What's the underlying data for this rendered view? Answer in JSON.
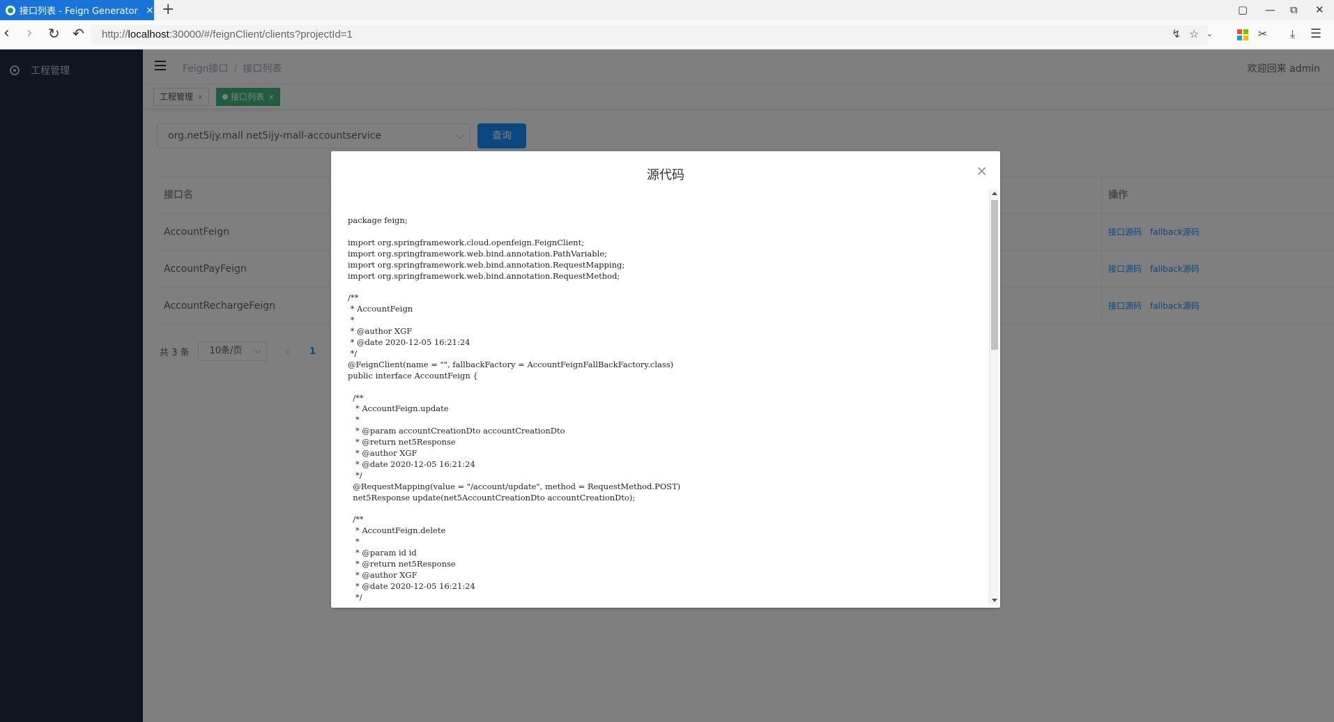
{
  "browser": {
    "tab_title": "接口列表 - Feign Generator S",
    "tab_close": "×",
    "new_tab": "+",
    "url_prefix": "http://",
    "url_host": "localhost",
    "url_rest": ":30000/#/feignClient/clients?projectId=1"
  },
  "sidebar": {
    "items": [
      {
        "label": "工程管理",
        "icon": "dashboard-icon"
      }
    ]
  },
  "navbar": {
    "breadcrumb": [
      "Feign接口",
      "接口列表"
    ],
    "breadcrumb_sep": "/",
    "welcome": "欢迎回来 admin"
  },
  "tags": [
    {
      "label": "工程管理",
      "active": false
    },
    {
      "label": "接口列表",
      "active": true
    }
  ],
  "filter": {
    "selected": "org.net5ijy.mall net5ijy-mall-accountservice",
    "query_label": "查询"
  },
  "table": {
    "headers": {
      "name": "接口名",
      "ops": "操作"
    },
    "rows": [
      {
        "name": "AccountFeign",
        "op1": "接口源码",
        "op2": "fallback源码"
      },
      {
        "name": "AccountPayFeign",
        "op1": "接口源码",
        "op2": "fallback源码"
      },
      {
        "name": "AccountRechargeFeign",
        "op1": "接口源码",
        "op2": "fallback源码"
      }
    ]
  },
  "pagination": {
    "total": "共 3 条",
    "page_size": "10条/页",
    "prev": "‹",
    "current": "1"
  },
  "dialog": {
    "title": "源代码",
    "close": "×",
    "code": "package feign;\n\nimport org.springframework.cloud.openfeign.FeignClient;\nimport org.springframework.web.bind.annotation.PathVariable;\nimport org.springframework.web.bind.annotation.RequestMapping;\nimport org.springframework.web.bind.annotation.RequestMethod;\n\n/**\n * AccountFeign\n *\n * @author XGF\n * @date 2020-12-05 16:21:24\n */\n@FeignClient(name = \"\", fallbackFactory = AccountFeignFallBackFactory.class)\npublic interface AccountFeign {\n\n  /**\n   * AccountFeign.update\n   *\n   * @param accountCreationDto accountCreationDto\n   * @return net5Response\n   * @author XGF\n   * @date 2020-12-05 16:21:24\n   */\n  @RequestMapping(value = \"/account/update\", method = RequestMethod.POST)\n  net5Response update(net5AccountCreationDto accountCreationDto);\n\n  /**\n   * AccountFeign.delete\n   *\n   * @param id id\n   * @return net5Response\n   * @author XGF\n   * @date 2020-12-05 16:21:24\n   */"
  },
  "colors": {
    "sidebar_bg": "#1f2d3d",
    "primary": "#1890ff",
    "tag_active": "#42b983",
    "tab_blue": "#1a73d9"
  }
}
